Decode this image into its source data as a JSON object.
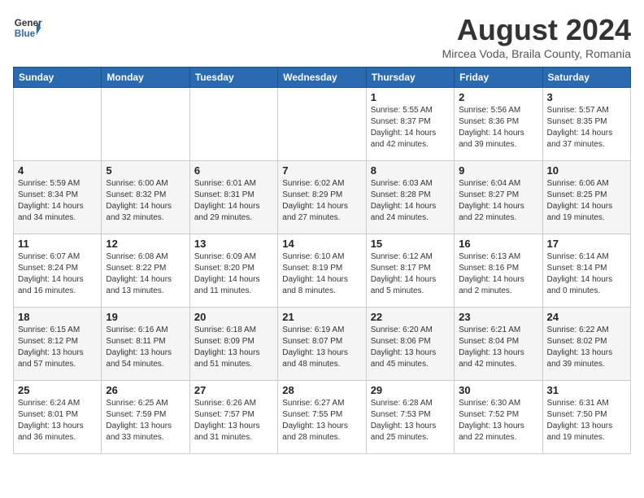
{
  "header": {
    "logo_line1": "General",
    "logo_line2": "Blue",
    "month": "August 2024",
    "location": "Mircea Voda, Braila County, Romania"
  },
  "weekdays": [
    "Sunday",
    "Monday",
    "Tuesday",
    "Wednesday",
    "Thursday",
    "Friday",
    "Saturday"
  ],
  "weeks": [
    [
      {
        "day": "",
        "info": ""
      },
      {
        "day": "",
        "info": ""
      },
      {
        "day": "",
        "info": ""
      },
      {
        "day": "",
        "info": ""
      },
      {
        "day": "1",
        "info": "Sunrise: 5:55 AM\nSunset: 8:37 PM\nDaylight: 14 hours\nand 42 minutes."
      },
      {
        "day": "2",
        "info": "Sunrise: 5:56 AM\nSunset: 8:36 PM\nDaylight: 14 hours\nand 39 minutes."
      },
      {
        "day": "3",
        "info": "Sunrise: 5:57 AM\nSunset: 8:35 PM\nDaylight: 14 hours\nand 37 minutes."
      }
    ],
    [
      {
        "day": "4",
        "info": "Sunrise: 5:59 AM\nSunset: 8:34 PM\nDaylight: 14 hours\nand 34 minutes."
      },
      {
        "day": "5",
        "info": "Sunrise: 6:00 AM\nSunset: 8:32 PM\nDaylight: 14 hours\nand 32 minutes."
      },
      {
        "day": "6",
        "info": "Sunrise: 6:01 AM\nSunset: 8:31 PM\nDaylight: 14 hours\nand 29 minutes."
      },
      {
        "day": "7",
        "info": "Sunrise: 6:02 AM\nSunset: 8:29 PM\nDaylight: 14 hours\nand 27 minutes."
      },
      {
        "day": "8",
        "info": "Sunrise: 6:03 AM\nSunset: 8:28 PM\nDaylight: 14 hours\nand 24 minutes."
      },
      {
        "day": "9",
        "info": "Sunrise: 6:04 AM\nSunset: 8:27 PM\nDaylight: 14 hours\nand 22 minutes."
      },
      {
        "day": "10",
        "info": "Sunrise: 6:06 AM\nSunset: 8:25 PM\nDaylight: 14 hours\nand 19 minutes."
      }
    ],
    [
      {
        "day": "11",
        "info": "Sunrise: 6:07 AM\nSunset: 8:24 PM\nDaylight: 14 hours\nand 16 minutes."
      },
      {
        "day": "12",
        "info": "Sunrise: 6:08 AM\nSunset: 8:22 PM\nDaylight: 14 hours\nand 13 minutes."
      },
      {
        "day": "13",
        "info": "Sunrise: 6:09 AM\nSunset: 8:20 PM\nDaylight: 14 hours\nand 11 minutes."
      },
      {
        "day": "14",
        "info": "Sunrise: 6:10 AM\nSunset: 8:19 PM\nDaylight: 14 hours\nand 8 minutes."
      },
      {
        "day": "15",
        "info": "Sunrise: 6:12 AM\nSunset: 8:17 PM\nDaylight: 14 hours\nand 5 minutes."
      },
      {
        "day": "16",
        "info": "Sunrise: 6:13 AM\nSunset: 8:16 PM\nDaylight: 14 hours\nand 2 minutes."
      },
      {
        "day": "17",
        "info": "Sunrise: 6:14 AM\nSunset: 8:14 PM\nDaylight: 14 hours\nand 0 minutes."
      }
    ],
    [
      {
        "day": "18",
        "info": "Sunrise: 6:15 AM\nSunset: 8:12 PM\nDaylight: 13 hours\nand 57 minutes."
      },
      {
        "day": "19",
        "info": "Sunrise: 6:16 AM\nSunset: 8:11 PM\nDaylight: 13 hours\nand 54 minutes."
      },
      {
        "day": "20",
        "info": "Sunrise: 6:18 AM\nSunset: 8:09 PM\nDaylight: 13 hours\nand 51 minutes."
      },
      {
        "day": "21",
        "info": "Sunrise: 6:19 AM\nSunset: 8:07 PM\nDaylight: 13 hours\nand 48 minutes."
      },
      {
        "day": "22",
        "info": "Sunrise: 6:20 AM\nSunset: 8:06 PM\nDaylight: 13 hours\nand 45 minutes."
      },
      {
        "day": "23",
        "info": "Sunrise: 6:21 AM\nSunset: 8:04 PM\nDaylight: 13 hours\nand 42 minutes."
      },
      {
        "day": "24",
        "info": "Sunrise: 6:22 AM\nSunset: 8:02 PM\nDaylight: 13 hours\nand 39 minutes."
      }
    ],
    [
      {
        "day": "25",
        "info": "Sunrise: 6:24 AM\nSunset: 8:01 PM\nDaylight: 13 hours\nand 36 minutes."
      },
      {
        "day": "26",
        "info": "Sunrise: 6:25 AM\nSunset: 7:59 PM\nDaylight: 13 hours\nand 33 minutes."
      },
      {
        "day": "27",
        "info": "Sunrise: 6:26 AM\nSunset: 7:57 PM\nDaylight: 13 hours\nand 31 minutes."
      },
      {
        "day": "28",
        "info": "Sunrise: 6:27 AM\nSunset: 7:55 PM\nDaylight: 13 hours\nand 28 minutes."
      },
      {
        "day": "29",
        "info": "Sunrise: 6:28 AM\nSunset: 7:53 PM\nDaylight: 13 hours\nand 25 minutes."
      },
      {
        "day": "30",
        "info": "Sunrise: 6:30 AM\nSunset: 7:52 PM\nDaylight: 13 hours\nand 22 minutes."
      },
      {
        "day": "31",
        "info": "Sunrise: 6:31 AM\nSunset: 7:50 PM\nDaylight: 13 hours\nand 19 minutes."
      }
    ]
  ]
}
